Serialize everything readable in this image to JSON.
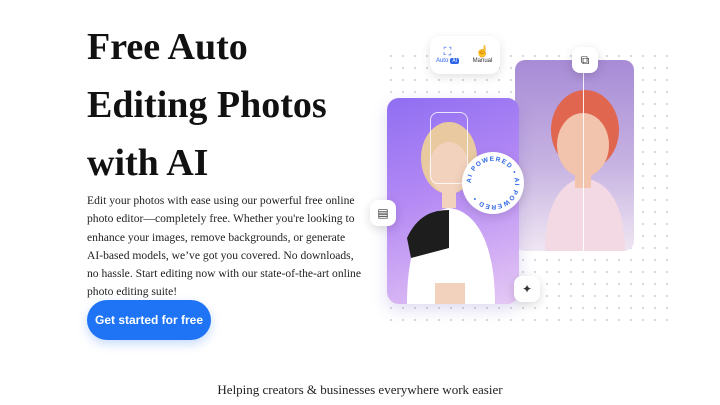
{
  "hero": {
    "title_lines": [
      "Free Auto",
      "Editing Photos",
      "with AI"
    ],
    "description": "Edit your photos with ease using our powerful free online photo editor—completely free. Whether you're looking to enhance your images, remove backgrounds, or generate AI-based models, we’ve got you covered. No downloads, no hassle. Start editing now with our state-of-the-art online photo editing suite!",
    "cta_label": "Get started for free"
  },
  "illustration": {
    "toolbar": {
      "auto_label": "Auto",
      "auto_badge": "AI",
      "manual_label": "Manual"
    },
    "ring_text": "AI POWERED • AI POWERED •",
    "icons": [
      "scan-icon",
      "hand-icon",
      "crop-icon",
      "layers-icon",
      "magic-wand-icon"
    ]
  },
  "footer": {
    "tagline": "Helping creators & businesses everywhere work easier"
  },
  "colors": {
    "cta": "#1e74f4",
    "accent": "#2f66e8",
    "photo_gradient_start": "#8f6ef2",
    "photo_gradient_end": "#e6c9f4"
  }
}
